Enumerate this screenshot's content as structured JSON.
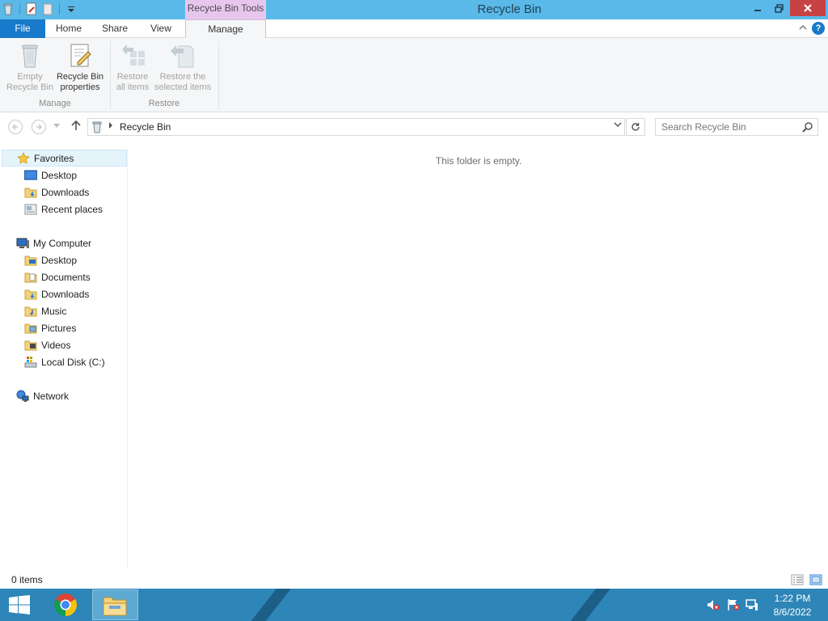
{
  "window": {
    "title": "Recycle Bin",
    "contextual_tab_group": "Recycle Bin Tools"
  },
  "ribbon": {
    "tabs": [
      {
        "label": "File"
      },
      {
        "label": "Home"
      },
      {
        "label": "Share"
      },
      {
        "label": "View"
      },
      {
        "label": "Manage"
      }
    ],
    "manage_group": {
      "label": "Manage",
      "empty_recycle_bin": {
        "line1": "Empty",
        "line2": "Recycle Bin"
      },
      "recycle_bin_properties": {
        "line1": "Recycle Bin",
        "line2": "properties"
      }
    },
    "restore_group": {
      "label": "Restore",
      "restore_all": {
        "line1": "Restore",
        "line2": "all items"
      },
      "restore_selected": {
        "line1": "Restore the",
        "line2": "selected items"
      }
    },
    "help_glyph": "?"
  },
  "address_bar": {
    "path": "Recycle Bin",
    "search_placeholder": "Search Recycle Bin"
  },
  "nav_pane": {
    "favorites": {
      "label": "Favorites",
      "items": [
        {
          "label": "Desktop"
        },
        {
          "label": "Downloads"
        },
        {
          "label": "Recent places"
        }
      ]
    },
    "computer": {
      "label": "My Computer",
      "items": [
        {
          "label": "Desktop"
        },
        {
          "label": "Documents"
        },
        {
          "label": "Downloads"
        },
        {
          "label": "Music"
        },
        {
          "label": "Pictures"
        },
        {
          "label": "Videos"
        },
        {
          "label": "Local Disk (C:)"
        }
      ]
    },
    "network": {
      "label": "Network"
    }
  },
  "content": {
    "empty_message": "This folder is empty."
  },
  "status_bar": {
    "item_count": "0 items"
  },
  "taskbar": {
    "clock_time": "1:22 PM",
    "clock_date": "8/6/2022"
  },
  "colors": {
    "title_bar": "#5ab9e8",
    "file_tab": "#1979ca",
    "context_tab": "#e7c6ee",
    "close_button": "#c74343",
    "taskbar": "#2e85b7"
  }
}
